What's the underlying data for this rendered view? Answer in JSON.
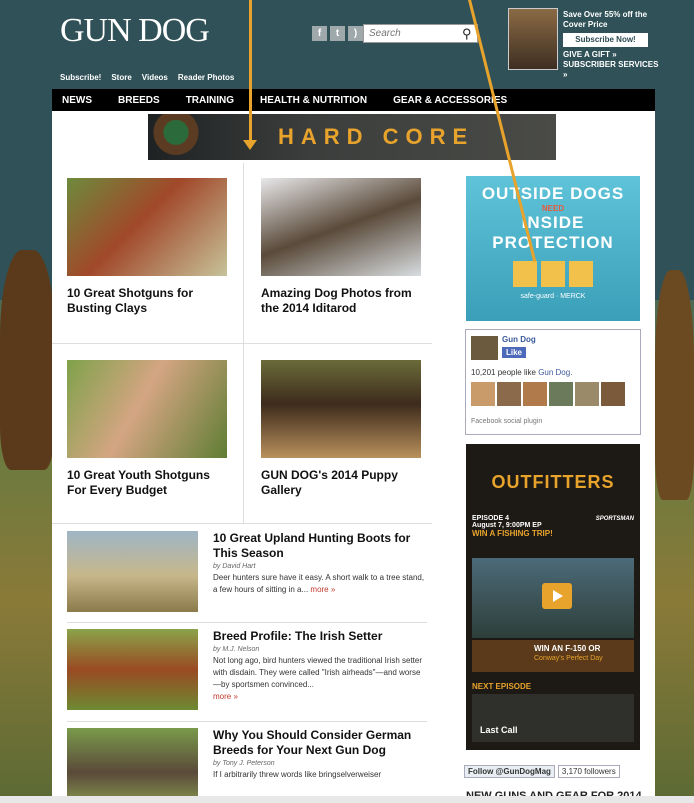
{
  "header": {
    "logo": "GUN DOG",
    "search_placeholder": "Search",
    "promo": {
      "headline": "Save Over 55% off the Cover Price",
      "subscribe": "Subscribe Now!",
      "gift": "GIVE A GIFT »",
      "services": "SUBSCRIBER SERVICES »"
    },
    "top_links": [
      "Subscribe!",
      "Store",
      "Videos",
      "Reader Photos"
    ]
  },
  "nav": [
    "NEWS",
    "BREEDS",
    "TRAINING",
    "HEALTH & NUTRITION",
    "GEAR & ACCESSORIES"
  ],
  "banner": {
    "text": "HARD CORE"
  },
  "cards": [
    {
      "title": "10 Great Shotguns for Busting Clays"
    },
    {
      "title": "Amazing Dog Photos from the 2014 Iditarod"
    },
    {
      "title": "10 Great Youth Shotguns For Every Budget"
    },
    {
      "title": "GUN DOG's 2014 Puppy Gallery"
    }
  ],
  "articles": [
    {
      "title": "10 Great Upland Hunting Boots for This Season",
      "byline": "by David Hart",
      "excerpt": "Deer hunters sure have it easy. A short walk to a tree stand, a few hours of sitting in a...",
      "more": "more »"
    },
    {
      "title": "Breed Profile: The Irish Setter",
      "byline": "by M.J. Nelson",
      "excerpt": "Not long ago, bird hunters viewed the traditional Irish setter with disdain. They were called \"Irish airheads\"—and worse—by sportsmen convinced...",
      "more": "more »"
    },
    {
      "title": "Why You Should Consider German Breeds for Your Next Gun Dog",
      "byline": "by Tony J. Peterson",
      "excerpt": "If I arbitrarily threw words like bringselverweiser",
      "more": ""
    }
  ],
  "ad_dogs": {
    "line1": "OUTSIDE DOGS",
    "line2": "NEED",
    "line3": "INSIDE PROTECTION",
    "brand": "safe-guard · MERCK"
  },
  "facebook": {
    "name": "Gun Dog",
    "like": "Like",
    "count": "10,201 people like",
    "count_link": "Gun Dog.",
    "plugin": "Facebook social plugin"
  },
  "outfitters": {
    "title": "OUTFITTERS",
    "episode": "EPISODE 4",
    "date": "August 7, 9:00PM EP",
    "network": "SPORTSMAN",
    "win1": "WIN A FISHING TRIP!",
    "win2": "WIN AN F-150 OR",
    "win2_sub": "Conway's Perfect Day",
    "next": "NEXT EPISODE",
    "last": "Last Call"
  },
  "twitter": {
    "follow": "Follow @GunDogMag",
    "followers": "3,170 followers"
  },
  "section_heading": "NEW GUNS AND GEAR FOR 2014",
  "colors": {
    "accent": "#e8a32c",
    "nav_bg": "#000000",
    "page_bg": "#2c4a50"
  }
}
